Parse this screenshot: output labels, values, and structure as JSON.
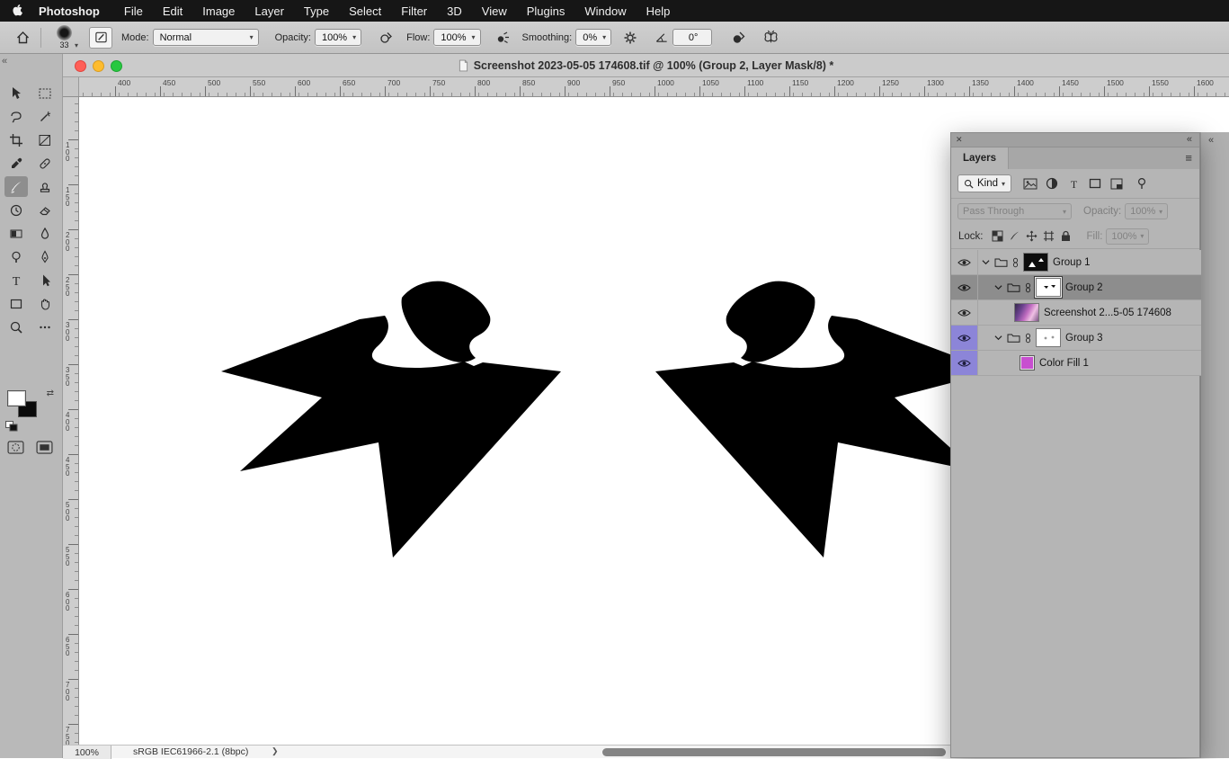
{
  "menu_bar": {
    "app_name": "Photoshop",
    "items": [
      "File",
      "Edit",
      "Image",
      "Layer",
      "Type",
      "Select",
      "Filter",
      "3D",
      "View",
      "Plugins",
      "Window",
      "Help"
    ]
  },
  "options_bar": {
    "brush_size": "33",
    "mode_label": "Mode:",
    "mode_value": "Normal",
    "opacity_label": "Opacity:",
    "opacity_value": "100%",
    "flow_label": "Flow:",
    "flow_value": "100%",
    "smoothing_label": "Smoothing:",
    "smoothing_value": "0%",
    "angle_value": "0°"
  },
  "window": {
    "title": "Screenshot 2023-05-05 174608.tif @ 100% (Group 2, Layer Mask/8) *"
  },
  "rulers": {
    "horizontal": [
      "400",
      "450",
      "500",
      "550",
      "600",
      "650",
      "700",
      "750",
      "800",
      "850",
      "900",
      "950",
      "1000",
      "1050",
      "1100",
      "1150",
      "1200",
      "1250",
      "1300",
      "1350",
      "1400",
      "1450",
      "1500",
      "1550",
      "1600"
    ],
    "vertical": [
      "100",
      "150",
      "200",
      "250",
      "300",
      "350",
      "400",
      "450",
      "500",
      "550",
      "600",
      "650",
      "700",
      "750"
    ]
  },
  "tools": {
    "selected": "brush",
    "items": [
      "move",
      "marquee",
      "lasso",
      "object-selection",
      "crop",
      "slice",
      "eyedropper",
      "spot-healing",
      "brush",
      "clone-stamp",
      "history-brush",
      "eraser",
      "gradient",
      "blur",
      "dodge",
      "pen",
      "type",
      "path-selection",
      "rectangle",
      "hand",
      "zoom",
      "more"
    ]
  },
  "layers_panel": {
    "tab_label": "Layers",
    "filter_label": "Kind",
    "blend_mode": "Pass Through",
    "opacity_label": "Opacity:",
    "opacity_value": "100%",
    "lock_label": "Lock:",
    "fill_label": "Fill:",
    "fill_value": "100%",
    "layers": [
      {
        "name": "Group 1",
        "type": "group",
        "visible": true
      },
      {
        "name": "Group 2",
        "type": "group",
        "visible": true,
        "selected": true
      },
      {
        "name": "Screenshot 2...5-05 174608",
        "type": "image",
        "visible": true
      },
      {
        "name": "Group 3",
        "type": "group",
        "visible": true,
        "eye_highlight": true
      },
      {
        "name": "Color Fill 1",
        "type": "fill",
        "visible": true,
        "eye_highlight": true
      }
    ]
  },
  "status_bar": {
    "zoom": "100%",
    "profile": "sRGB IEC61966-2.1 (8bpc)"
  },
  "icons": {
    "collapse": "«",
    "close": "✕",
    "menu": "≡",
    "caret": "▾",
    "chevron": "❯",
    "swap": "⇄"
  },
  "colors": {
    "menubar_bg": "#161616",
    "panel_bg": "#b5b5b5",
    "selected_row": "#8d8d8d",
    "eye_highlight_purple": "#8c85d8",
    "fill_swatch_magenta": "#c84fd0",
    "traffic_red": "#ff5f57",
    "traffic_yellow": "#febc2e",
    "traffic_green": "#28c840"
  }
}
